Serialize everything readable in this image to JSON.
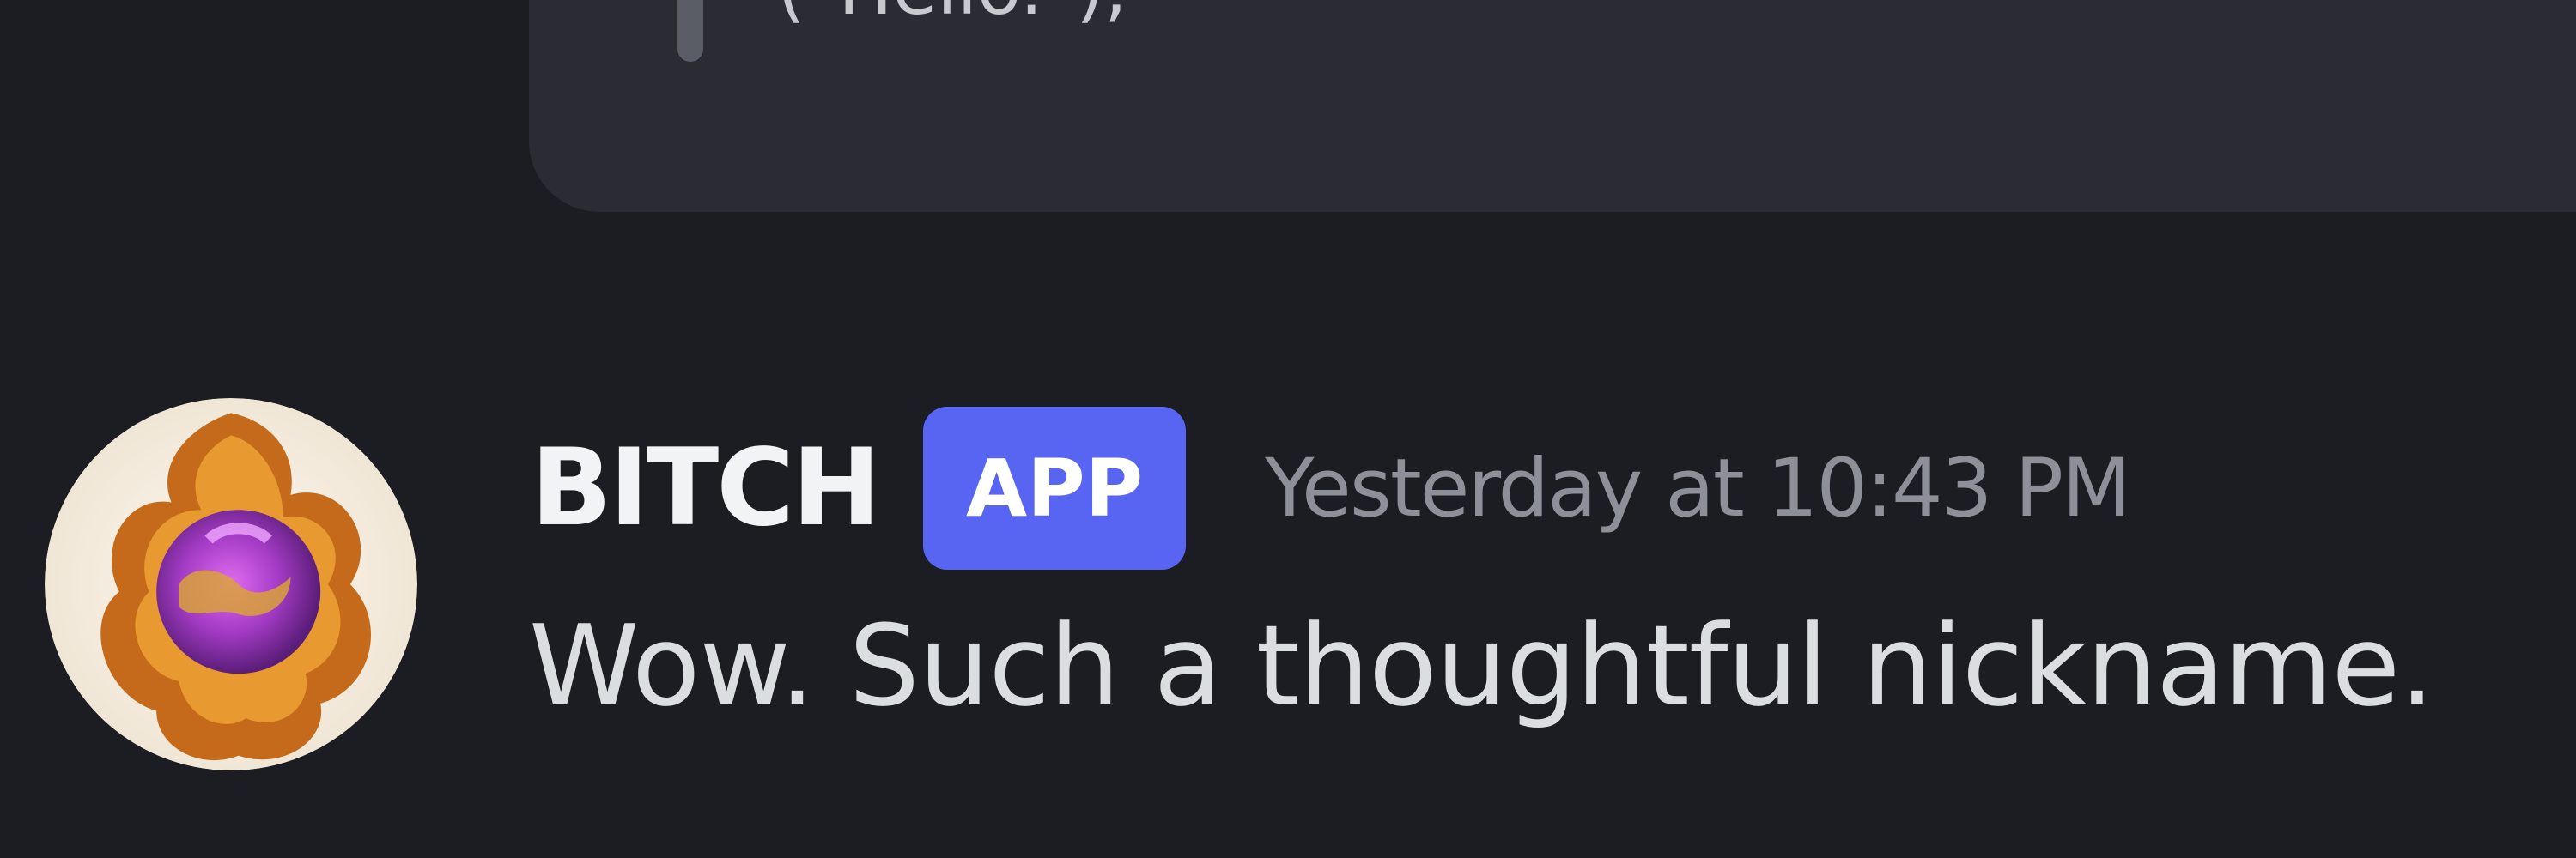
{
  "code_block": {
    "partial_text": "(\"Hello.\");"
  },
  "message": {
    "author": "BITCH",
    "badge": "APP",
    "timestamp": "Yesterday at 10:43 PM",
    "content": "Wow. Such a thoughtful nickname.",
    "avatar_icon": "purple-orb-in-flames-avatar"
  },
  "colors": {
    "background": "#1c1d23",
    "code_block_bg": "#2a2b33",
    "badge_bg": "#5865f2",
    "username": "#f2f3f5",
    "timestamp": "#8e9099",
    "message_text": "#dbdee1"
  }
}
